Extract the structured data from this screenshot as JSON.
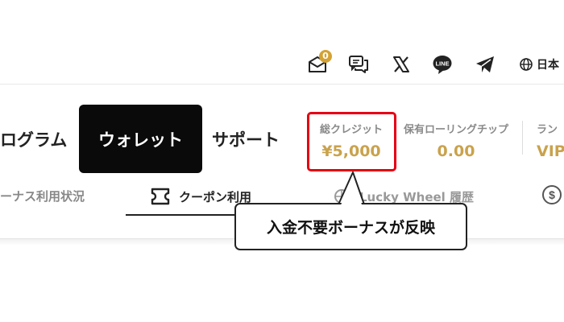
{
  "header": {
    "mail_badge_count": "0",
    "icons": [
      "mail-icon",
      "chat-icon",
      "x-icon",
      "line-icon",
      "telegram-icon",
      "globe-icon"
    ],
    "language": "日本"
  },
  "nav": {
    "program": "ログラム",
    "wallet": "ウォレット",
    "support": "サポート"
  },
  "stats": {
    "credit_label": "総クレジット",
    "credit_value": "¥5,000",
    "rolling_label": "保有ローリングチップ",
    "rolling_value": "0.00",
    "rank_label": "ラン",
    "rank_value": "VIP"
  },
  "subtabs": {
    "bonus": "ーナス利用状況",
    "coupon": "クーポン利用",
    "lucky": "Lucky Wheel 履歴"
  },
  "callout": {
    "text": "入金不要ボーナスが反映"
  },
  "colors": {
    "accent_gold": "#c9a24c",
    "highlight_red": "#e60012",
    "active_tab_bg": "#0a0a0a"
  }
}
